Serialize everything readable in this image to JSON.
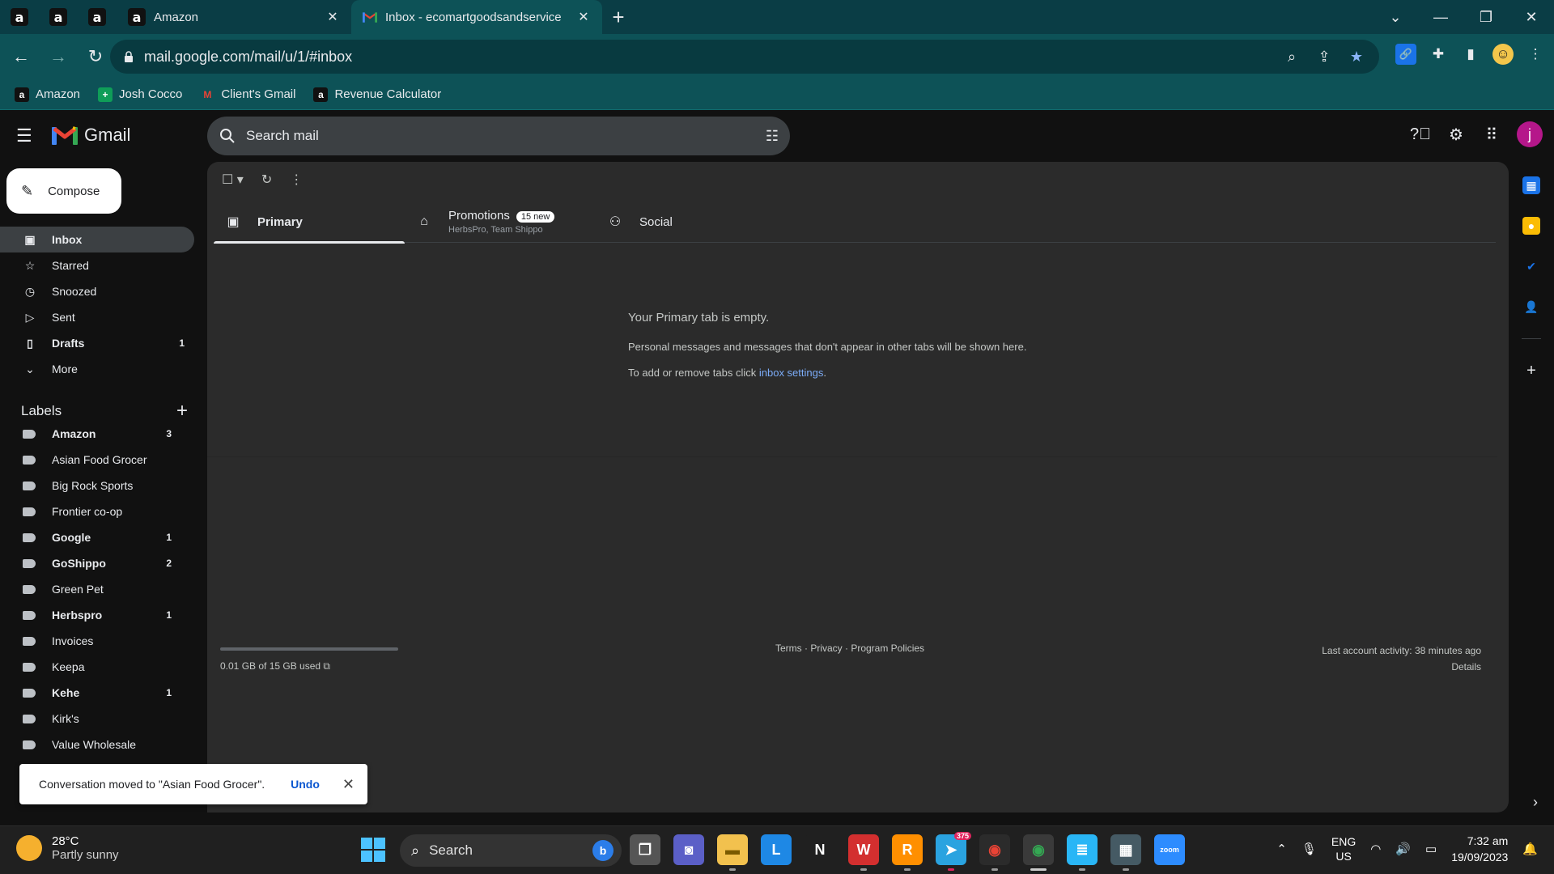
{
  "browser": {
    "tabs": [
      {
        "title": "Amazon"
      },
      {
        "title": "Inbox - ecomartgoodsandservice"
      }
    ],
    "url": "mail.google.com/mail/u/1/#inbox",
    "bookmarks": [
      "Amazon",
      "Josh Cocco",
      "Client's Gmail",
      "Revenue Calculator"
    ]
  },
  "gmail": {
    "brand": "Gmail",
    "search_placeholder": "Search mail",
    "compose": "Compose",
    "avatar_letter": "j",
    "nav": [
      {
        "label": "Inbox",
        "count": ""
      },
      {
        "label": "Starred",
        "count": ""
      },
      {
        "label": "Snoozed",
        "count": ""
      },
      {
        "label": "Sent",
        "count": ""
      },
      {
        "label": "Drafts",
        "count": "1"
      },
      {
        "label": "More",
        "count": ""
      }
    ],
    "labels_title": "Labels",
    "labels": [
      {
        "label": "Amazon",
        "count": "3"
      },
      {
        "label": "Asian Food Grocer",
        "count": ""
      },
      {
        "label": "Big Rock Sports",
        "count": ""
      },
      {
        "label": "Frontier co-op",
        "count": ""
      },
      {
        "label": "Google",
        "count": "1"
      },
      {
        "label": "GoShippo",
        "count": "2"
      },
      {
        "label": "Green Pet",
        "count": ""
      },
      {
        "label": "Herbspro",
        "count": "1"
      },
      {
        "label": "Invoices",
        "count": ""
      },
      {
        "label": "Keepa",
        "count": ""
      },
      {
        "label": "Kehe",
        "count": "1"
      },
      {
        "label": "Kirk's",
        "count": ""
      },
      {
        "label": "Value Wholesale",
        "count": ""
      }
    ],
    "tabs": {
      "primary": "Primary",
      "promotions": "Promotions",
      "promotions_badge": "15 new",
      "promotions_sub": "HerbsPro, Team Shippo",
      "social": "Social"
    },
    "empty": {
      "heading": "Your Primary tab is empty.",
      "line1": "Personal messages and messages that don't appear in other tabs will be shown here.",
      "line2_prefix": "To add or remove tabs click ",
      "line2_link": "inbox settings",
      "line2_suffix": "."
    },
    "storage": "0.01 GB of 15 GB used",
    "footer_links": "Terms · Privacy · Program Policies",
    "last_activity": "Last account activity: 38 minutes ago",
    "details": "Details",
    "snackbar": {
      "message": "Conversation moved to \"Asian Food Grocer\".",
      "action": "Undo"
    }
  },
  "taskbar": {
    "temp": "28°C",
    "weather": "Partly sunny",
    "search": "Search",
    "telegram_badge": "375",
    "lang1": "ENG",
    "lang2": "US",
    "time": "7:32 am",
    "date": "19/09/2023"
  },
  "colors": {
    "accent_teal": "#0d5257",
    "gmail_avatar": "#b5178a",
    "link": "#7cacf8"
  }
}
